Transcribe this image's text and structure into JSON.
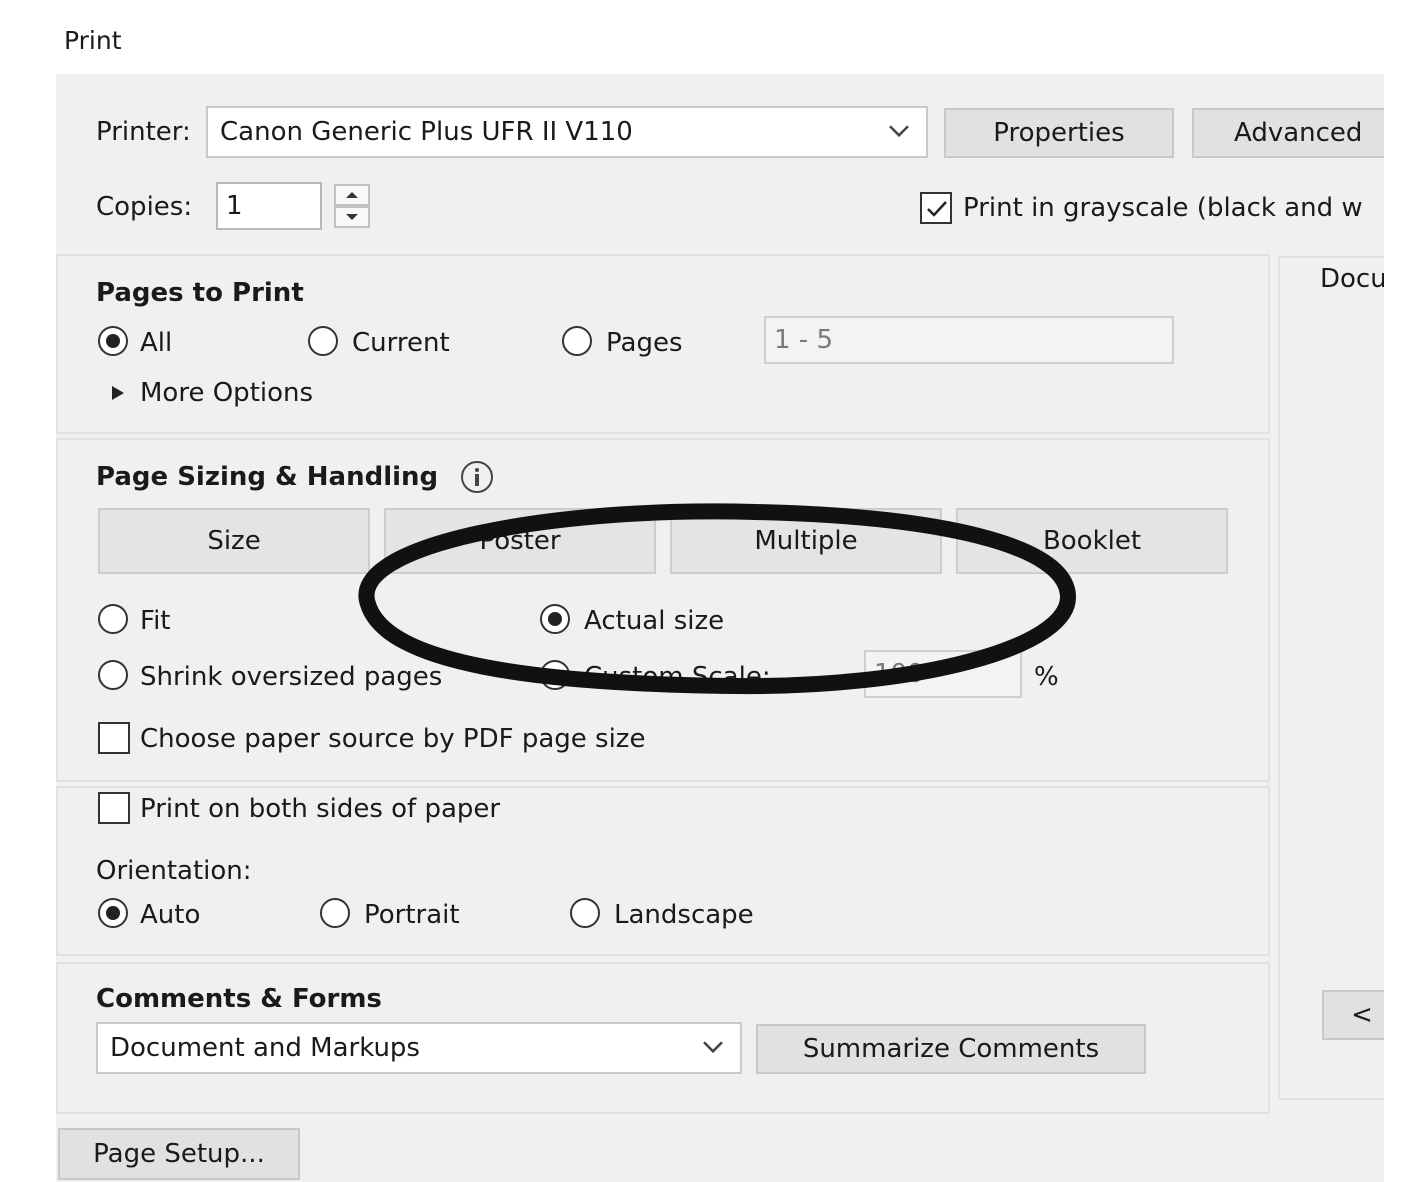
{
  "window": {
    "title": "Print"
  },
  "printer": {
    "label": "Printer:",
    "selected": "Canon Generic Plus UFR II V110",
    "properties_label": "Properties",
    "advanced_label": "Advanced"
  },
  "copies": {
    "label": "Copies:",
    "value": "1"
  },
  "grayscale": {
    "label": "Print in grayscale (black and w",
    "checked": true
  },
  "preview": {
    "heading": "Docu",
    "prev_label": "<"
  },
  "pages_to_print": {
    "heading": "Pages to Print",
    "options": [
      {
        "label": "All",
        "selected": true
      },
      {
        "label": "Current",
        "selected": false
      },
      {
        "label": "Pages",
        "selected": false
      }
    ],
    "pages_value": "1 - 5",
    "more_options": "More Options"
  },
  "page_sizing": {
    "heading": "Page Sizing & Handling",
    "tabs": [
      "Size",
      "Poster",
      "Multiple",
      "Booklet"
    ],
    "fit_label": "Fit",
    "actual_label": "Actual size",
    "shrink_label": "Shrink oversized pages",
    "custom_label": "Custom Scale:",
    "custom_value": "100",
    "percent": "%",
    "paper_source_label": "Choose paper source by PDF page size"
  },
  "duplex": {
    "label": "Print on both sides of paper",
    "checked": false
  },
  "orientation": {
    "label": "Orientation:",
    "options": [
      {
        "label": "Auto",
        "selected": true
      },
      {
        "label": "Portrait",
        "selected": false
      },
      {
        "label": "Landscape",
        "selected": false
      }
    ]
  },
  "comments_forms": {
    "heading": "Comments & Forms",
    "selected": "Document and Markups",
    "summarize_label": "Summarize Comments"
  },
  "page_setup_label": "Page Setup...",
  "colors": {
    "dialog_bg": "#f0f0f0",
    "button_bg": "#e1e1e1",
    "annotation": "#111111"
  }
}
